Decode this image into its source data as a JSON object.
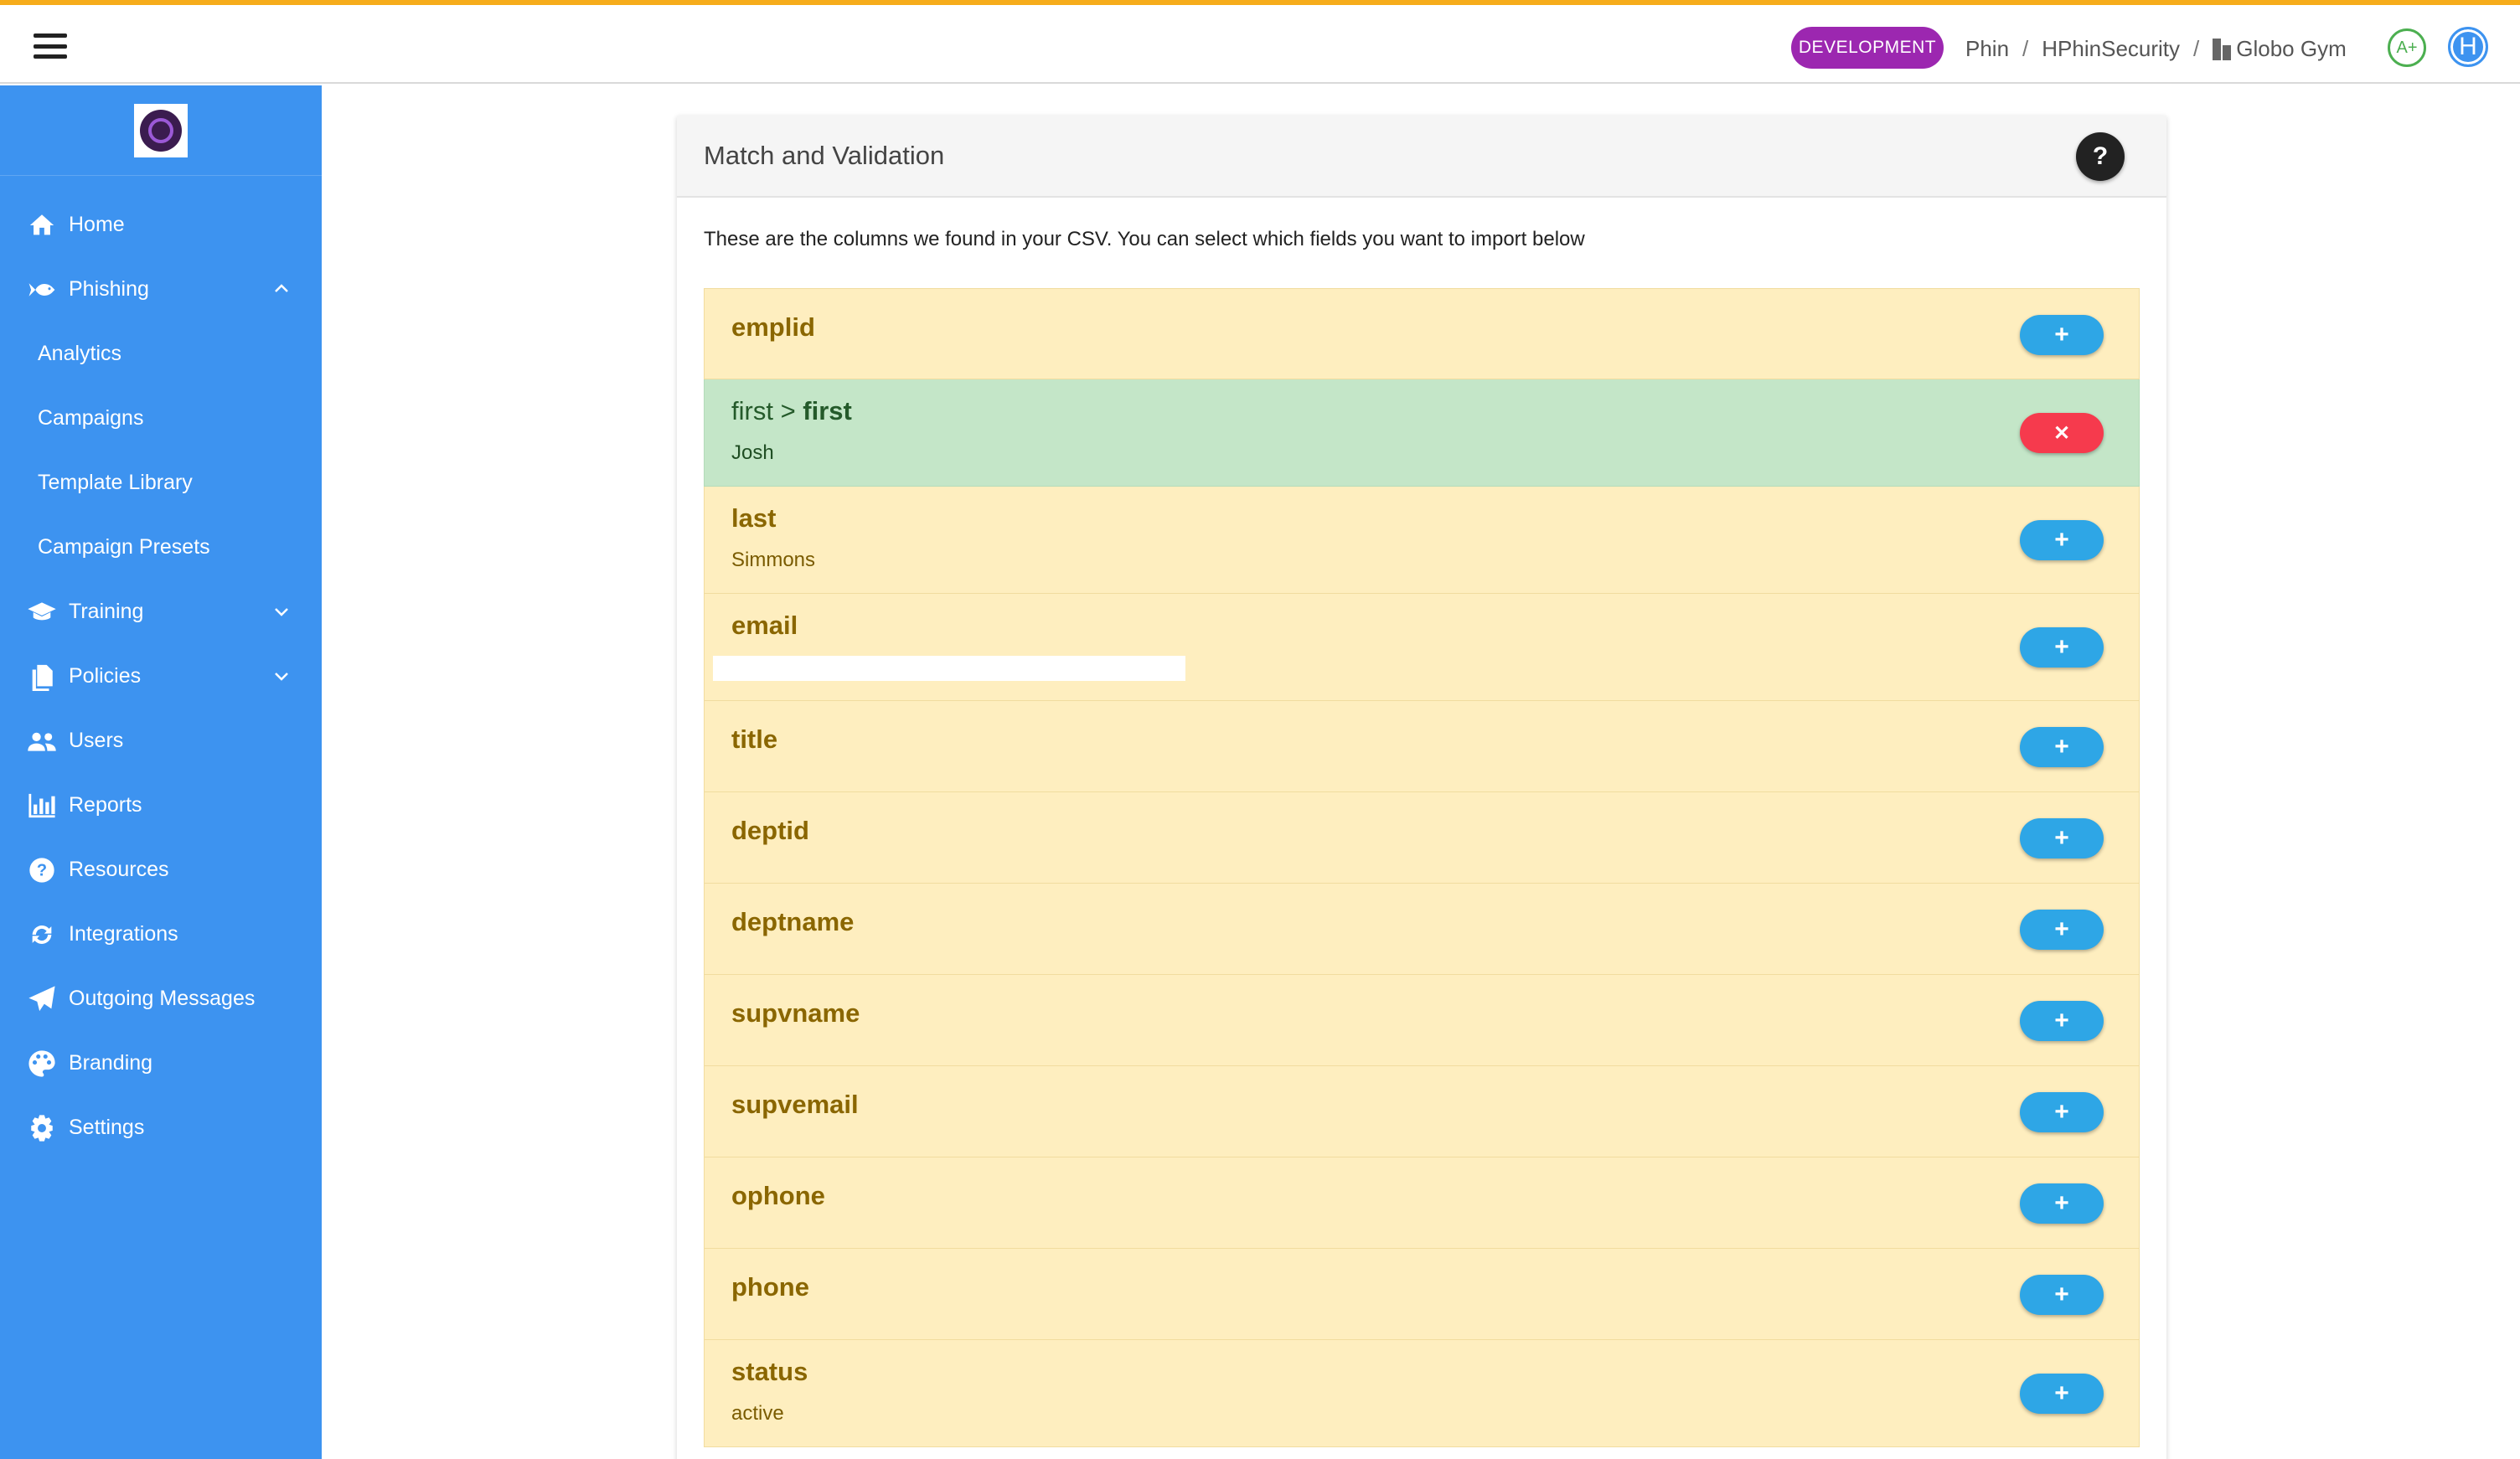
{
  "topbar": {
    "environment": "DEVELOPMENT",
    "breadcrumb": [
      "Phin",
      "HPhinSecurity",
      "Globo Gym"
    ],
    "grade": "A+",
    "user_initial": "H"
  },
  "sidebar": {
    "items": [
      {
        "label": "Home",
        "icon": "home-icon"
      },
      {
        "label": "Phishing",
        "icon": "fish-icon",
        "expanded": true
      },
      {
        "label": "Analytics",
        "sub": true
      },
      {
        "label": "Campaigns",
        "sub": true
      },
      {
        "label": "Template Library",
        "sub": true
      },
      {
        "label": "Campaign Presets",
        "sub": true
      },
      {
        "label": "Training",
        "icon": "graduation-cap-icon",
        "expanded": false
      },
      {
        "label": "Policies",
        "icon": "documents-icon",
        "expanded": false
      },
      {
        "label": "Users",
        "icon": "users-icon"
      },
      {
        "label": "Reports",
        "icon": "bar-chart-icon"
      },
      {
        "label": "Resources",
        "icon": "question-circle-icon"
      },
      {
        "label": "Integrations",
        "icon": "sync-icon"
      },
      {
        "label": "Outgoing Messages",
        "icon": "paper-plane-icon"
      },
      {
        "label": "Branding",
        "icon": "palette-icon"
      },
      {
        "label": "Settings",
        "icon": "gear-icon"
      }
    ]
  },
  "card": {
    "title": "Match and Validation",
    "help_label": "?",
    "description": "These are the columns we found in your CSV. You can select which fields you want to import below",
    "rows": [
      {
        "column": "emplid",
        "sample": "",
        "matched": false
      },
      {
        "column": "first",
        "mapped_to": "first",
        "arrow": ">",
        "sample": "Josh",
        "matched": true
      },
      {
        "column": "last",
        "sample": "Simmons",
        "matched": false
      },
      {
        "column": "email",
        "sample": "",
        "redacted": true,
        "matched": false
      },
      {
        "column": "title",
        "sample": "",
        "matched": false
      },
      {
        "column": "deptid",
        "sample": "",
        "matched": false
      },
      {
        "column": "deptname",
        "sample": "",
        "matched": false
      },
      {
        "column": "supvname",
        "sample": "",
        "matched": false
      },
      {
        "column": "supvemail",
        "sample": "",
        "matched": false
      },
      {
        "column": "ophone",
        "sample": "",
        "matched": false
      },
      {
        "column": "phone",
        "sample": "",
        "matched": false
      },
      {
        "column": "status",
        "sample": "active",
        "matched": false
      }
    ],
    "add_label": "+",
    "remove_label": "✕"
  },
  "colors": {
    "accent_bar": "#f6ac1b",
    "sidebar": "#3d93f0",
    "environment_badge": "#9c27b0",
    "unmatched_row": "#feeebf",
    "matched_row": "#c4e6c8",
    "add_button": "#2ea6e6",
    "remove_button": "#f63a4d"
  }
}
